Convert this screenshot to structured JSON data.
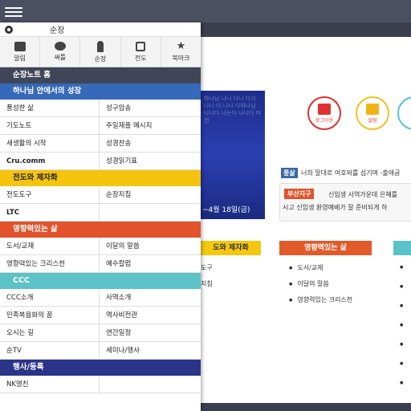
{
  "drawer": {
    "user_name": "순장",
    "quick": [
      {
        "icon": "megaphone-icon",
        "label": "알림"
      },
      {
        "icon": "chat-bubble-icon",
        "label": "써틀"
      },
      {
        "icon": "person-icon",
        "label": "순장"
      },
      {
        "icon": "edit-icon",
        "label": "전도"
      },
      {
        "icon": "star-icon",
        "label": "북마크"
      }
    ],
    "home_label": "순장노트 홈",
    "sections": [
      {
        "title": "하나님 안에서의 성장",
        "color": "#3669b9",
        "items": [
          "풍성한 삶",
          "성구암송",
          "기도노트",
          "주일재플 메시지",
          "새생활의 시작",
          "성경찬송",
          "Cru.comm",
          "성경읽기표"
        ]
      },
      {
        "title": "전도와 제자화",
        "color": "#f5c40e",
        "items": [
          "전도도구",
          "순장지침",
          "LTC",
          ""
        ]
      },
      {
        "title": "영향력있는 삶",
        "color": "#e2522b",
        "items": [
          "도서/교재",
          "이달의 말씀",
          "영향력있는 크리스천",
          "예수칼럼"
        ]
      },
      {
        "title": "CCC",
        "color": "#5bc2c7",
        "items": [
          "CCC소개",
          "사역소개",
          "민족복음화의 꿈",
          "역사비전관",
          "오시는 길",
          "연간일정",
          "순TV",
          "세미나/행사"
        ]
      },
      {
        "title": "행사/등록",
        "color": "#2a3488",
        "items": [
          "NK영친",
          ""
        ]
      }
    ]
  },
  "background": {
    "banner_caption": "~4월 18일(금)",
    "banner_deco": "하나님 나니 다니 다가 나니 다 니나 다하나님 나니다 나는다 나니다 미션",
    "logout_label": "로그아웃",
    "alarm_label": "알림",
    "notice_tag": "풍삶",
    "notice_text": "너희 말대로 여호와를 섬기며 -출애굽",
    "news_tag": "부산지구",
    "news_line1": "신입생 사역가운데 은혜를",
    "news_line2": "시고 신입생 환영예배가 잘 준비되게 하",
    "col1_head": "도와 제자화",
    "col1_items": [
      "도구",
      "지침"
    ],
    "col2_head": "영향력있는 삶",
    "col2_items": [
      "도서/교재",
      "이달의 말씀",
      "영향력있는 크리스천"
    ]
  }
}
